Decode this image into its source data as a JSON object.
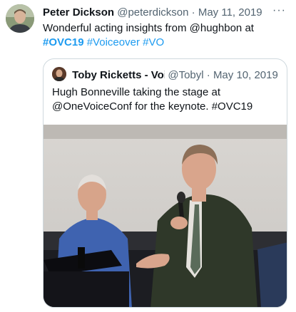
{
  "tweet": {
    "author_name": "Peter Dickson",
    "author_handle": "@peterdickson",
    "separator": "·",
    "date": "May 11, 2019",
    "more_label": "···",
    "text_before": "Wonderful acting insights from @hughbon at",
    "hashtags": [
      "#OVC19",
      "#Voiceover",
      "#VO"
    ]
  },
  "quoted_tweet": {
    "author_name": "Toby Ricketts - Voi",
    "author_handle": "@Tobyl",
    "separator": "·",
    "date": "May 10, 2019",
    "text": "Hugh Bonneville taking the stage at @OneVoiceConf for the keynote. #OVC19"
  },
  "colors": {
    "link": "#1d9bf0",
    "secondary": "#536471",
    "border": "#cfd9de"
  }
}
